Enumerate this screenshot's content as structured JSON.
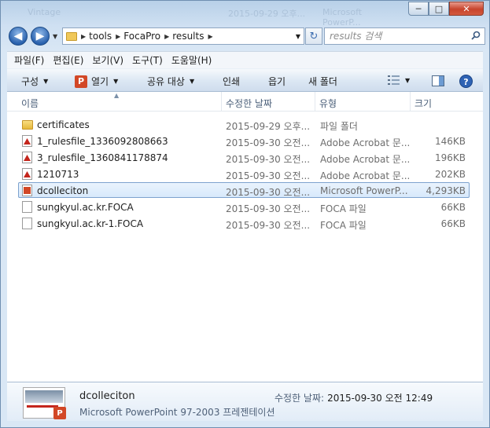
{
  "window": {
    "ghost_texts": [
      "Vintage",
      "2015-09-29 오후...",
      "Microsoft PowerP..."
    ],
    "caption": {
      "minimize": "─",
      "maximize": "□",
      "close": "✕"
    }
  },
  "navigation": {
    "back": "◀",
    "forward": "▶",
    "breadcrumb": [
      "tools",
      "FocaPro",
      "results"
    ],
    "search_placeholder": "results 검색"
  },
  "menu": [
    "파일(F)",
    "편집(E)",
    "보기(V)",
    "도구(T)",
    "도움말(H)"
  ],
  "commands": {
    "organize": "구성",
    "open": "열기",
    "share": "공유 대상",
    "print": "인쇄",
    "email": "읍기",
    "new_folder": "새 폴더"
  },
  "columns": {
    "name": "이름",
    "date": "수정한 날짜",
    "type": "유형",
    "size": "크기"
  },
  "files": [
    {
      "name": "certificates",
      "date": "2015-09-29 오후...",
      "type": "파일 폴더",
      "size": "",
      "icon": "folder-icon"
    },
    {
      "name": "1_rulesfile_1336092808663",
      "date": "2015-09-30 오전...",
      "type": "Adobe Acrobat 문...",
      "size": "146KB",
      "icon": "pdf-icon"
    },
    {
      "name": "3_rulesfile_1360841178874",
      "date": "2015-09-30 오전...",
      "type": "Adobe Acrobat 문...",
      "size": "196KB",
      "icon": "pdf-icon"
    },
    {
      "name": "1210713",
      "date": "2015-09-30 오전...",
      "type": "Adobe Acrobat 문...",
      "size": "202KB",
      "icon": "pdf-icon"
    },
    {
      "name": "dcolleciton",
      "date": "2015-09-30 오전...",
      "type": "Microsoft PowerP...",
      "size": "4,293KB",
      "icon": "powerpoint-icon",
      "selected": true
    },
    {
      "name": "sungkyul.ac.kr.FOCA",
      "date": "2015-09-30 오전...",
      "type": "FOCA 파일",
      "size": "66KB",
      "icon": "file-icon"
    },
    {
      "name": "sungkyul.ac.kr-1.FOCA",
      "date": "2015-09-30 오전...",
      "type": "FOCA 파일",
      "size": "66KB",
      "icon": "file-icon"
    }
  ],
  "details": {
    "name": "dcolleciton",
    "type": "Microsoft PowerPoint 97-2003 프레젠테이션",
    "modified_label": "수정한 날짜:",
    "modified_value": "2015-09-30 오전 12:49"
  },
  "colors": {
    "selection_border": "#7da2ce",
    "accent": "#2a62ae"
  }
}
